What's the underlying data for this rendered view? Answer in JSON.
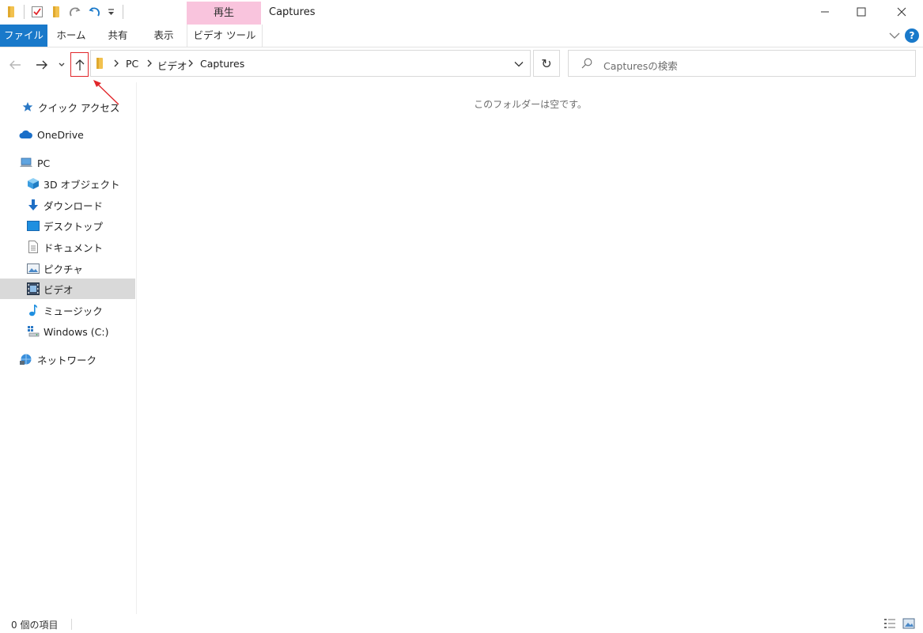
{
  "window": {
    "title": "Captures",
    "context_group_label": "再生"
  },
  "quick_access_toolbar": {
    "icons": [
      "folder-icon",
      "properties-icon",
      "new-folder-icon",
      "redo-icon",
      "undo-icon",
      "customize-dropdown-icon"
    ]
  },
  "ribbon": {
    "tabs": [
      {
        "label": "ファイル",
        "active": true
      },
      {
        "label": "ホーム"
      },
      {
        "label": "共有"
      },
      {
        "label": "表示"
      },
      {
        "label": "ビデオ ツール"
      }
    ],
    "help_label": "?"
  },
  "navigation": {
    "breadcrumb": [
      "PC",
      "ビデオ",
      "Captures"
    ],
    "refresh_glyph": "↻",
    "search_placeholder": "Capturesの検索"
  },
  "sidebar": {
    "items": [
      {
        "label": "クイック アクセス",
        "icon": "star-icon",
        "level": 0
      },
      {
        "label": "OneDrive",
        "icon": "cloud-icon",
        "level": 0
      },
      {
        "label": "PC",
        "icon": "computer-icon",
        "level": 0
      },
      {
        "label": "3D オブジェクト",
        "icon": "cube-icon",
        "level": 1
      },
      {
        "label": "ダウンロード",
        "icon": "download-arrow-icon",
        "level": 1
      },
      {
        "label": "デスクトップ",
        "icon": "desktop-icon",
        "level": 1
      },
      {
        "label": "ドキュメント",
        "icon": "document-icon",
        "level": 1
      },
      {
        "label": "ピクチャ",
        "icon": "picture-icon",
        "level": 1
      },
      {
        "label": "ビデオ",
        "icon": "film-icon",
        "level": 1,
        "selected": true
      },
      {
        "label": "ミュージック",
        "icon": "music-note-icon",
        "level": 1
      },
      {
        "label": "Windows (C:)",
        "icon": "drive-icon",
        "level": 1
      },
      {
        "label": "ネットワーク",
        "icon": "network-icon",
        "level": 0
      }
    ]
  },
  "content": {
    "empty_message": "このフォルダーは空です。"
  },
  "status_bar": {
    "item_count": "0 個の項目"
  },
  "colors": {
    "accent": "#1979ca",
    "context_tab": "#f9c4dd",
    "highlight_annotation": "#e1262a",
    "selected_row": "#d9d9d9"
  }
}
